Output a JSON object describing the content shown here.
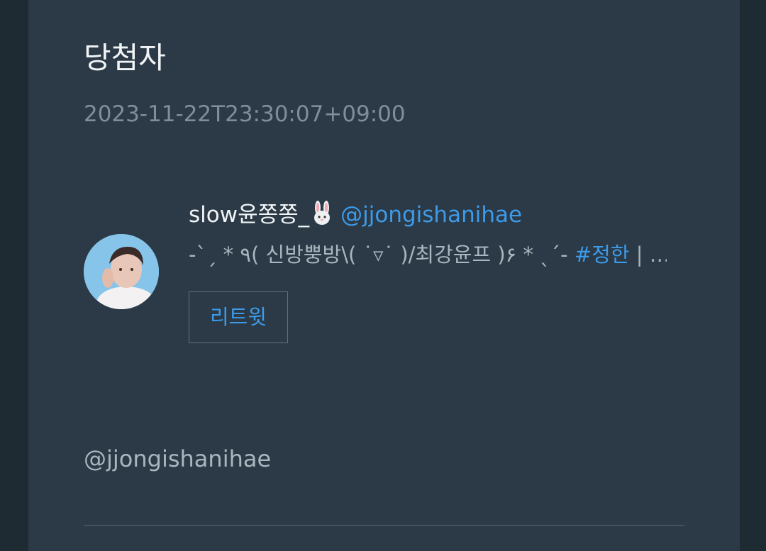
{
  "post": {
    "title": "당첨자",
    "timestamp": "2023-11-22T23:30:07+09:00"
  },
  "profile": {
    "display_name": "slow윤쫑쫑_",
    "emoji_icon": "rabbit-face-icon",
    "handle": "@jjongishanihae",
    "bio_text": "-ˋˏ * ٩( 신방뿡방\\( ˙▿˙ )/최강윤프 )۶ * ˎˊ- ",
    "bio_hashtag": "#정한",
    "bio_tail": " | …",
    "retweet_label": "리트윗"
  },
  "mention": "@jjongishanihae",
  "colors": {
    "background": "#1f2b33",
    "card": "#2b3a46",
    "accent": "#3d9bea",
    "muted_text": "#7f8e9a"
  }
}
